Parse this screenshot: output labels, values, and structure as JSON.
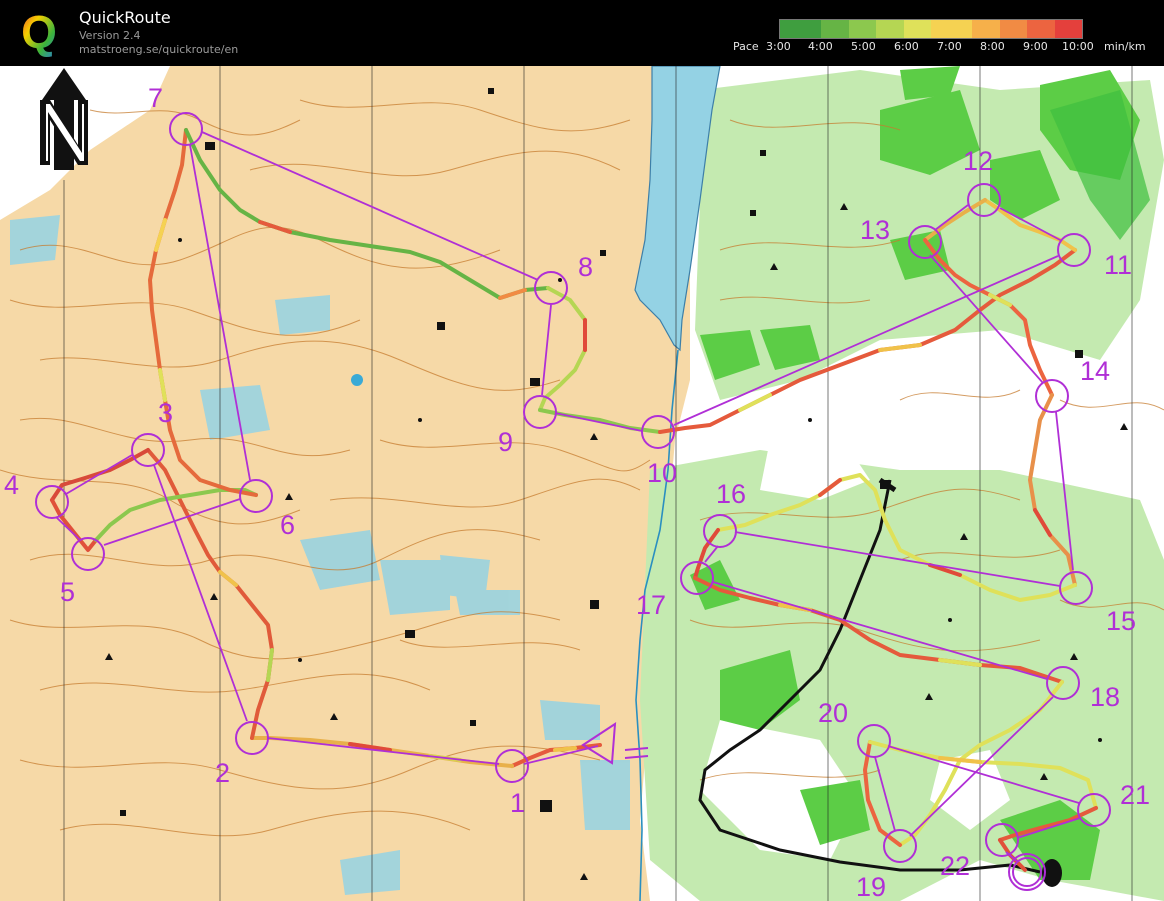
{
  "app": {
    "logo_letter": "Q",
    "title": "QuickRoute",
    "version": "Version 2.4",
    "url": "matstroeng.se/quickroute/en"
  },
  "pace_legend": {
    "label": "Pace",
    "ticks": [
      "3:00",
      "4:00",
      "5:00",
      "6:00",
      "7:00",
      "8:00",
      "9:00",
      "10:00"
    ],
    "unit": "min/km",
    "gradient_colors": [
      "#3f9e3f",
      "#66b445",
      "#8cc84e",
      "#b5d653",
      "#dfe15a",
      "#f5d252",
      "#f6b04a",
      "#f18b44",
      "#ec6440",
      "#e4403c"
    ]
  },
  "map": {
    "north_arrow": "north-arrow-icon",
    "course_color": "#b02fd6",
    "colors": {
      "terrain_open": "#f6d9a7",
      "forest_white": "#ffffff",
      "forest_green_light": "#c4eab0",
      "forest_green_dark": "#5ccd46",
      "lake": "#94d2e4",
      "contour": "#c67c2f"
    },
    "control_labels": [
      "1",
      "2",
      "3",
      "4",
      "5",
      "6",
      "7",
      "8",
      "9",
      "10",
      "11",
      "12",
      "13",
      "14",
      "15",
      "16",
      "17",
      "18",
      "19",
      "20",
      "21",
      "22"
    ]
  }
}
